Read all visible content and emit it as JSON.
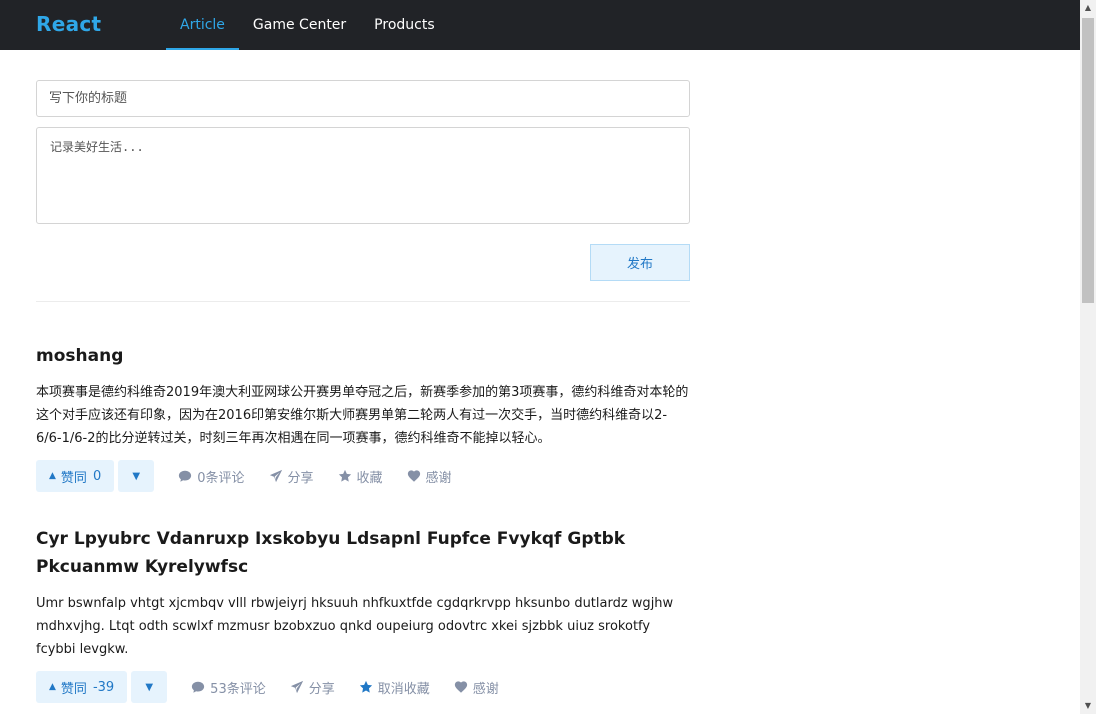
{
  "header": {
    "brand": "React",
    "nav": [
      {
        "label": "Article",
        "active": true
      },
      {
        "label": "Game Center",
        "active": false
      },
      {
        "label": "Products",
        "active": false
      }
    ]
  },
  "editor": {
    "title_placeholder": "写下你的标题",
    "content_placeholder": "记录美好生活...",
    "publish_label": "发布"
  },
  "articles": [
    {
      "title": "moshang",
      "body": "本项赛事是德约科维奇2019年澳大利亚网球公开赛男单夺冠之后，新赛季参加的第3项赛事，德约科维奇对本轮的这个对手应该还有印象，因为在2016印第安维尔斯大师赛男单第二轮两人有过一次交手，当时德约科维奇以2-6/6-1/6-2的比分逆转过关，时刻三年再次相遇在同一项赛事，德约科维奇不能掉以轻心。",
      "upvote_label": "赞同",
      "upvote_count": "0",
      "comment_label": "0条评论",
      "share_label": "分享",
      "favorite_label": "收藏",
      "favorite_active": false,
      "thanks_label": "感谢"
    },
    {
      "title": "Cyr Lpyubrc Vdanruxp Ixskobyu Ldsapnl Fupfce Fvykqf Gptbk Pkcuanmw Kyrelywfsc",
      "body": "Umr bswnfalp vhtgt xjcmbqv vlll rbwjeiyrj hksuuh nhfkuxtfde cgdqrkrvpp hksunbo dutlardz wgjhw mdhxvjhg. Ltqt odth scwlxf mzmusr bzobxzuo qnkd oupeiurg odovtrc xkei sjzbbk uiuz srokotfy fcybbi levgkw.",
      "upvote_label": "赞同",
      "upvote_count": "-39",
      "comment_label": "53条评论",
      "share_label": "分享",
      "favorite_label": "取消收藏",
      "favorite_active": true,
      "thanks_label": "感谢"
    }
  ],
  "colors": {
    "header_bg": "#212327",
    "accent": "#2fa7e8",
    "button_bg": "#e6f3fd",
    "button_text": "#2178c6",
    "meta_text": "#8590a6"
  }
}
